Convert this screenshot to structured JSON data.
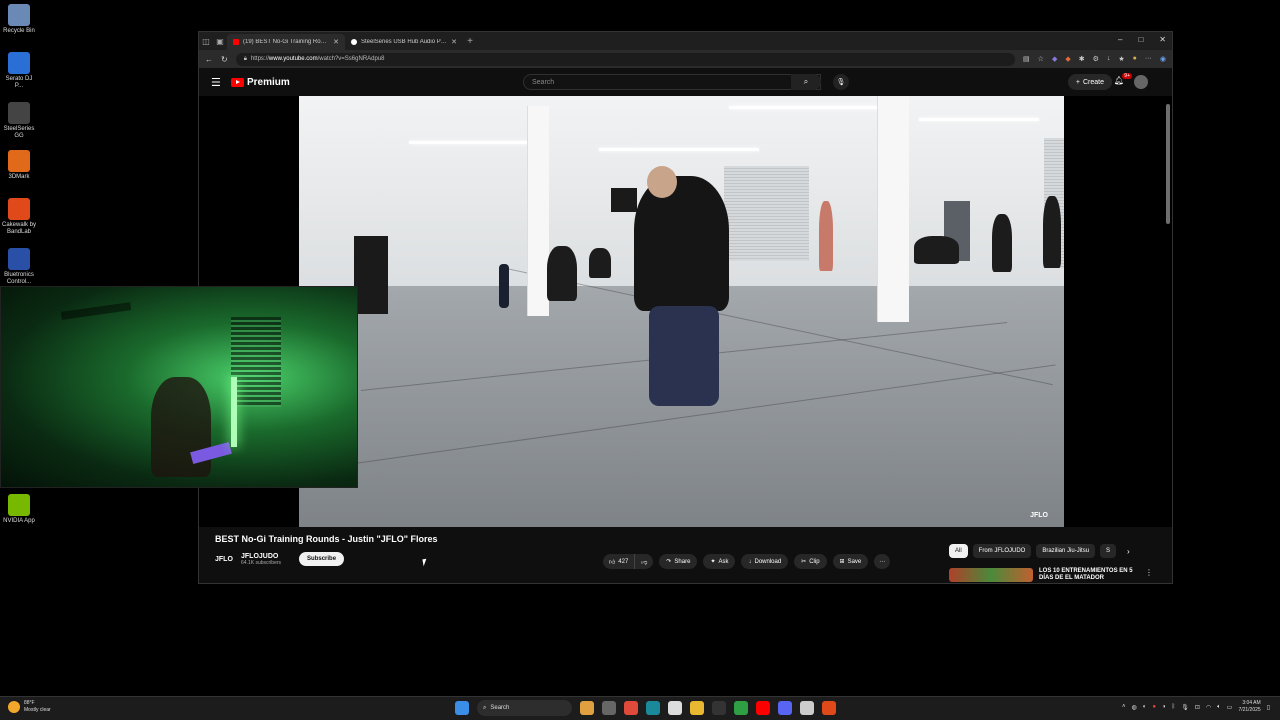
{
  "desktop": {
    "icons": [
      {
        "label": "Recycle Bin",
        "icon": "recycle-bin-icon",
        "color": "#6a8ab5"
      },
      {
        "label": "Serato DJ P...",
        "icon": "serato-icon",
        "color": "#2a6fd6"
      },
      {
        "label": "SteelSeries GG",
        "icon": "steelseries-icon",
        "color": "#444444"
      },
      {
        "label": "3DMark",
        "icon": "3dmark-icon",
        "color": "#e06a1a"
      },
      {
        "label": "Cakewalk by BandLab",
        "icon": "cakewalk-icon",
        "color": "#e04a1a"
      },
      {
        "label": "Bluetronics Control...",
        "icon": "bluetronics-icon",
        "color": "#2a4fa6"
      },
      {
        "label": "NVIDIA App",
        "icon": "nvidia-icon",
        "color": "#76b900"
      }
    ]
  },
  "browser": {
    "tabs": [
      {
        "label": "(19) BEST No-Gi Training Rounds",
        "active": true,
        "fav_color": "#ff0000"
      },
      {
        "label": "SteelSeries USB Hub Audio Port",
        "active": false,
        "fav_color": "#ffffff"
      }
    ],
    "new_tab": "+",
    "url_prefix": "https://",
    "url_host": "www.youtube.com",
    "url_path": "/watch?v=Ss6gNRAdpu8",
    "window": {
      "minimize": "–",
      "maximize": "□",
      "close": "✕"
    }
  },
  "youtube": {
    "logo_text": "Premium",
    "search_placeholder": "Search",
    "create_label": "Create",
    "notifications": "9+",
    "video": {
      "title": "BEST No-Gi Training Rounds - Justin \"JFLO\" Flores",
      "watermark": "JFLO",
      "channel_logo": "JFLO",
      "channel": "JFLOJUDO",
      "subscribers": "64.1K subscribers",
      "subscribe_label": "Subscribe",
      "likes": "427"
    },
    "actions": [
      {
        "label": "Share",
        "icon": "share-icon",
        "glyph": "↷"
      },
      {
        "label": "Ask",
        "icon": "sparkle-icon",
        "glyph": "✦"
      },
      {
        "label": "Download",
        "icon": "download-icon",
        "glyph": "↓"
      },
      {
        "label": "Clip",
        "icon": "scissors-icon",
        "glyph": "✂"
      },
      {
        "label": "Save",
        "icon": "bookmark-icon",
        "glyph": "⊞"
      }
    ],
    "more_glyph": "···",
    "chips": [
      {
        "label": "All",
        "selected": true
      },
      {
        "label": "From JFLOJUDO",
        "selected": false
      },
      {
        "label": "Brazilian Jiu-Jitsu",
        "selected": false
      },
      {
        "label": "S",
        "selected": false
      }
    ],
    "recommended": [
      {
        "title": "LOS 10 ENTRENAMIENTOS EN 5 DÍAS DE EL MATADOR"
      }
    ]
  },
  "taskbar": {
    "weather_temp": "88°F",
    "weather_desc": "Mostly clear",
    "search_label": "Search",
    "time": "3:04 AM",
    "date": "7/21/2025",
    "apps": [
      {
        "icon": "windows-start-icon",
        "color": "#3a8ee6"
      },
      {
        "icon": "copilot-icon",
        "color": "#e0a040"
      },
      {
        "icon": "task-view-icon",
        "color": "#666666"
      },
      {
        "icon": "chrome-icon",
        "color": "#e04a3a"
      },
      {
        "icon": "edge-icon",
        "color": "#1a8a9a"
      },
      {
        "icon": "store-icon",
        "color": "#dddddd"
      },
      {
        "icon": "explorer-icon",
        "color": "#e8b830"
      },
      {
        "icon": "terminal-icon",
        "color": "#333333"
      },
      {
        "icon": "xbox-icon",
        "color": "#2ea043"
      },
      {
        "icon": "youtube-music-icon",
        "color": "#ff0000"
      },
      {
        "icon": "discord-icon",
        "color": "#5865f2"
      },
      {
        "icon": "steelseries-tb-icon",
        "color": "#cccccc"
      },
      {
        "icon": "git-icon",
        "color": "#e04a1a"
      }
    ]
  }
}
